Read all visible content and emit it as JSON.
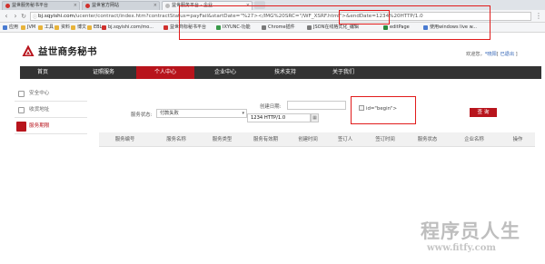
{
  "browser": {
    "tabs": [
      {
        "label": "益世服务秘书平台"
      },
      {
        "label": "益世官方网站"
      },
      {
        "label": "益世服务平台 - 企业..."
      }
    ],
    "url": {
      "host": "bj.sqyishi.com",
      "path": "/ucenter/contract/index.htm?contractStatus=payFail&startDate=\"%27></IMG%20SRC=\"/WF_XSRF.html\">&endDate=1234%20HTTP/1.0"
    },
    "bookmarks": [
      {
        "label": "应用",
        "color": "#4a7bd1"
      },
      {
        "label": "JVM",
        "color": "#e8b33a"
      },
      {
        "label": "工具",
        "color": "#e8b33a"
      },
      {
        "label": "资料",
        "color": "#e8b33a"
      },
      {
        "label": "博文",
        "color": "#e8b33a"
      },
      {
        "label": "EBL",
        "color": "#e8b33a"
      },
      {
        "label": "bj.sqyishi.com/mo...",
        "color": "#d0312d"
      },
      {
        "label": "益世商标秘书平台",
        "color": "#d0312d"
      },
      {
        "label": "IXYUNC-功能",
        "color": "#3a9a4a"
      },
      {
        "label": "Chrome插件",
        "color": "#7a7a7a"
      },
      {
        "label": "JSON在线格式化_编辑",
        "color": "#7a7a7a"
      },
      {
        "label": "editPage",
        "color": "#2b8a3e"
      },
      {
        "label": "使用windows live w...",
        "color": "#4a7bd1"
      }
    ]
  },
  "site": {
    "logo_text": "益世商务秘书",
    "welcome": "欢迎您，",
    "welcome_link1": "*晓阳",
    "welcome_sep": "[ ",
    "welcome_link2": "已退出",
    "welcome_end": " ]",
    "nav": [
      {
        "label": "首页"
      },
      {
        "label": "证照服务"
      },
      {
        "label": "个人中心"
      },
      {
        "label": "企业中心"
      },
      {
        "label": "技术支持"
      },
      {
        "label": "关于我们"
      }
    ],
    "nav_active_index": 2,
    "sidebar": [
      {
        "label": "安全中心"
      },
      {
        "label": "收货地址"
      },
      {
        "label": "服务期限"
      }
    ],
    "sidebar_active_index": 2
  },
  "filter": {
    "status_label": "服务状态:",
    "status_value": "付款失败",
    "date_label": "创建日期:",
    "start_date_value": "",
    "end_date_value": "1234 HTTP/1.0",
    "injected_img_text": "id=\"begin\">",
    "query_button": "查 询"
  },
  "table": {
    "headers": [
      "服务编号",
      "服务名称",
      "服务类型",
      "服务有效期",
      "创建时间",
      "签订人",
      "签订时间",
      "服务状态",
      "企业名称",
      "操作"
    ]
  },
  "watermark": {
    "line1": "程序员人生",
    "line2": "www.fitfy.com"
  },
  "colors": {
    "brand_red": "#b8141c",
    "nav_dark": "#333333",
    "highlight_red": "#e11b1b"
  }
}
